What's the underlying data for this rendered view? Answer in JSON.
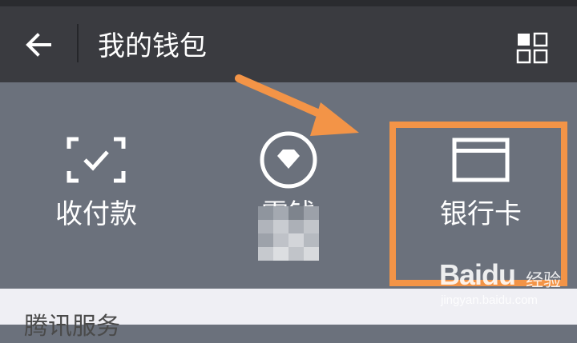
{
  "header": {
    "title": "我的钱包",
    "back_icon": "arrow-left-icon",
    "more_icon": "grid-apps-icon"
  },
  "wallet": {
    "items": [
      {
        "label": "收付款",
        "icon": "scan-check-icon"
      },
      {
        "label": "零钱",
        "icon": "diamond-coin-icon"
      },
      {
        "label": "银行卡",
        "icon": "bank-card-icon"
      }
    ]
  },
  "services": {
    "title": "腾讯服务"
  },
  "watermark": {
    "logo": "Baidu",
    "tag": "经验",
    "url": "jingyan.baidu.com"
  },
  "colors": {
    "header_bg": "#3a3b40",
    "panel_bg": "#6b717c",
    "services_bg": "#efeff4",
    "annotation": "#f39447",
    "text_light": "#ffffff"
  }
}
